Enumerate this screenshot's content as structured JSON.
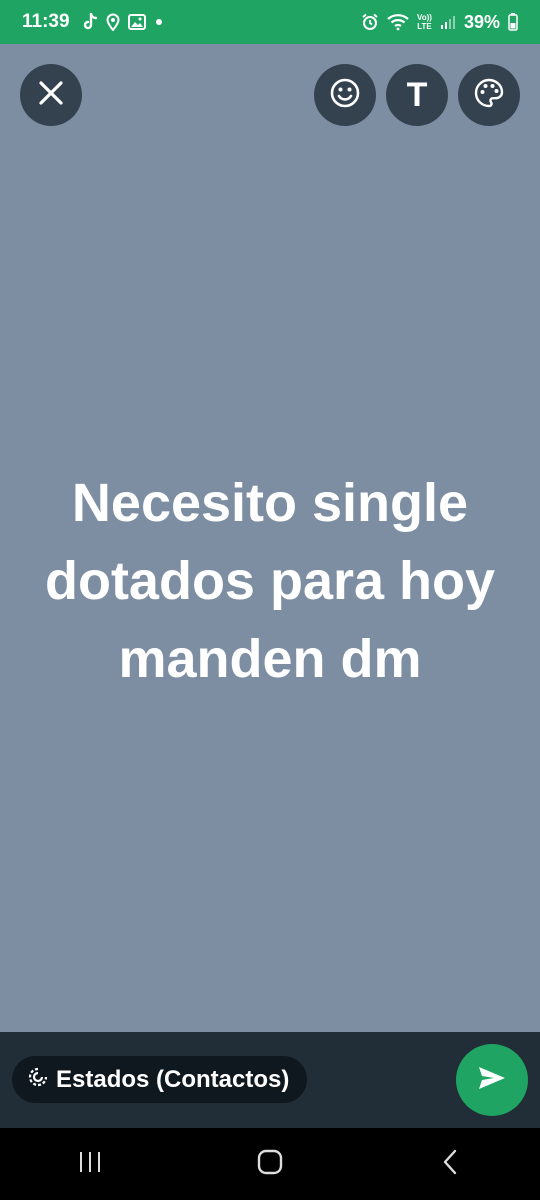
{
  "status_bar": {
    "time": "11:39",
    "battery": "39%",
    "left_icons": [
      "tiktok-icon",
      "location-icon",
      "gallery-icon",
      "dot-icon"
    ],
    "right_icons": [
      "alarm-icon",
      "wifi-icon",
      "volte-icon",
      "signal-icon",
      "battery-icon"
    ],
    "volte_top": "Vo))",
    "volte_bottom": "LTE"
  },
  "toolbar": {
    "close_icon": "close-icon",
    "emoji_icon": "emoji-icon",
    "text_label": "T",
    "palette_icon": "palette-icon"
  },
  "status": {
    "text": "Necesito single dotados para hoy manden dm",
    "background_color": "#7d8ea3"
  },
  "composer": {
    "audience_label": "Estados (Contactos)",
    "send_icon": "send-icon"
  },
  "colors": {
    "accent": "#1fa463",
    "button_bg": "#344250",
    "composer_bg": "#222e37"
  }
}
